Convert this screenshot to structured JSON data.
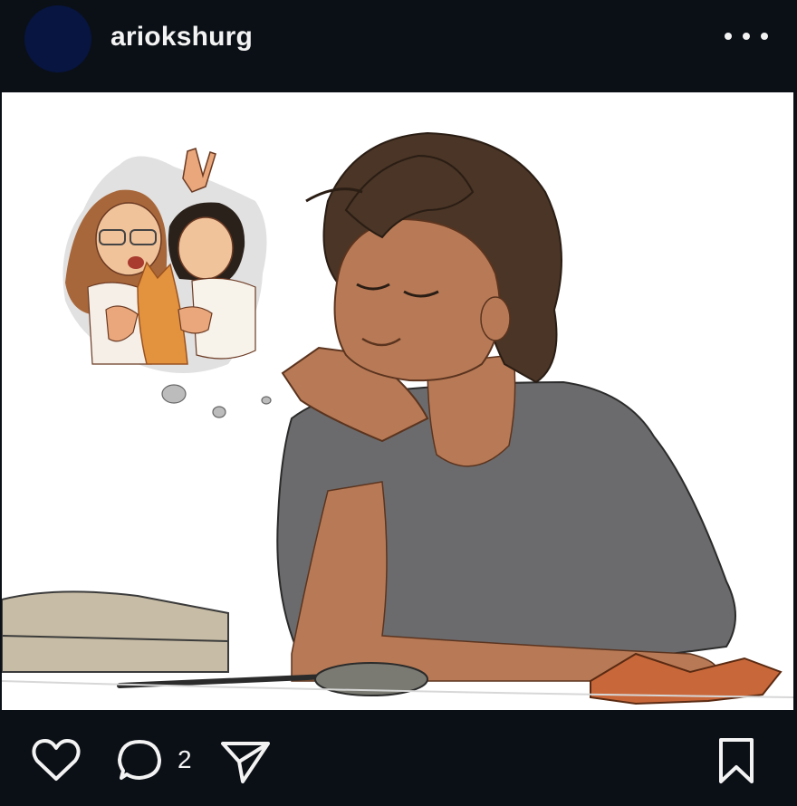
{
  "post": {
    "username": "ariokshurg",
    "avatar_color": "#071540",
    "icons": {
      "more": "more-options-icon",
      "like": "heart-icon",
      "comment": "comment-icon",
      "share": "send-icon",
      "save": "bookmark-icon"
    },
    "comment_count": "2"
  },
  "image": {
    "description": "",
    "colors": {
      "skin": "#b87a56",
      "hair": "#4a3526",
      "shirt": "#6b6b6d",
      "background": "#ffffff"
    }
  }
}
